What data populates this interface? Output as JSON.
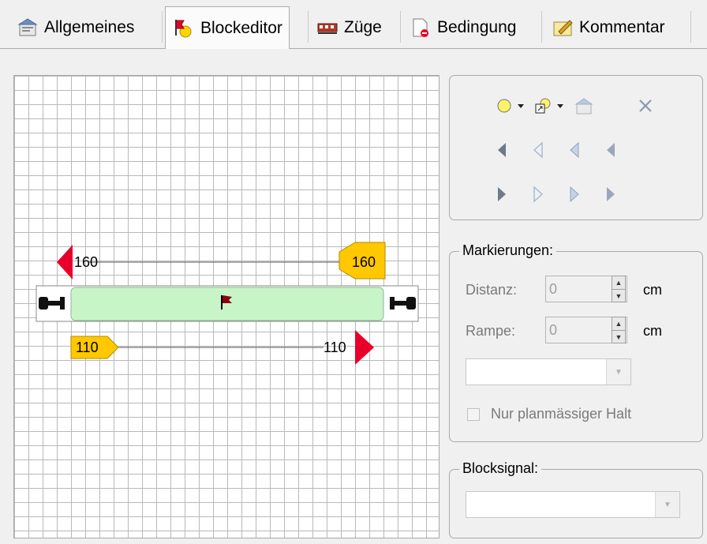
{
  "tabs": [
    {
      "label": "Allgemeines",
      "icon": "properties-icon"
    },
    {
      "label": "Blockeditor",
      "icon": "signal-flag-icon"
    },
    {
      "label": "Züge",
      "icon": "train-icon"
    },
    {
      "label": "Bedingung",
      "icon": "condition-icon"
    },
    {
      "label": "Kommentar",
      "icon": "comment-icon"
    }
  ],
  "canvas": {
    "marker_top_left": "160",
    "marker_top_right": "160",
    "marker_bottom_left": "110",
    "marker_bottom_right": "110"
  },
  "markierungen": {
    "legend": "Markierungen:",
    "distanz_label": "Distanz:",
    "distanz_value": "0",
    "distanz_unit": "cm",
    "rampe_label": "Rampe:",
    "rampe_value": "0",
    "rampe_unit": "cm",
    "checkbox_label": "Nur planmässiger Halt"
  },
  "blocksignal": {
    "legend": "Blocksignal:"
  },
  "colors": {
    "block_fill": "#c8f5c8",
    "marker_red": "#e8002a",
    "marker_yellow": "#ffc800"
  }
}
